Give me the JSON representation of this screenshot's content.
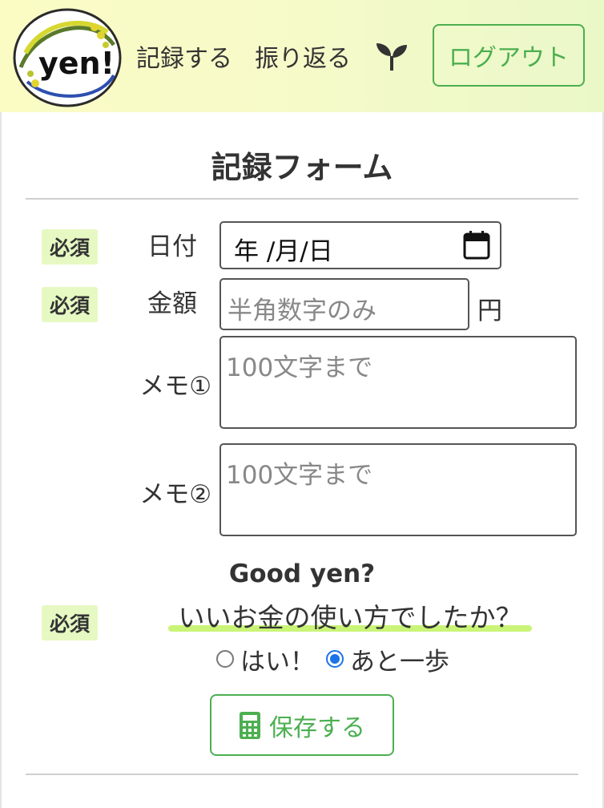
{
  "header": {
    "logo_text": "yen!",
    "nav_record": "記録する",
    "nav_review": "振り返る",
    "logout": "ログアウト"
  },
  "form": {
    "title": "記録フォーム",
    "required": "必須",
    "date_label": "日付",
    "date_value": "年 /月/日",
    "amount_label": "金額",
    "amount_placeholder": "半角数字のみ",
    "amount_unit": "円",
    "memo1_label": "メモ①",
    "memo1_placeholder": "100文字まで",
    "memo2_label": "メモ②",
    "memo2_placeholder": "100文字まで",
    "good_title": "Good yen?",
    "question": "いいお金の使い方でしたか？",
    "option_yes": "はい！",
    "option_almost": "あと一歩",
    "selected_option": "あと一歩",
    "save": "保存する"
  },
  "colors": {
    "accent_green": "#4caf50",
    "badge_bg": "#e6f9c3",
    "highlight_green": "#c9f477",
    "radio_blue": "#1a73e8"
  },
  "icons": [
    "sprout-icon",
    "calendar-icon",
    "calculator-icon"
  ]
}
